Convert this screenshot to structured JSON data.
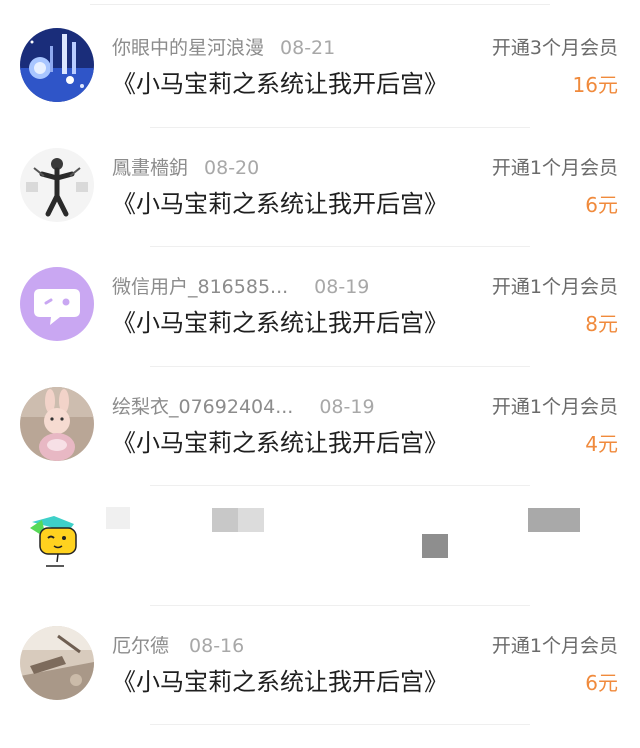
{
  "purchases": [
    {
      "username": "你眼中的星河浪漫",
      "date": "08-21",
      "book_title": "《小马宝莉之系统让我开后宫》",
      "plan": "开通3个月会员",
      "price": "16元",
      "avatar": "galaxy-icon"
    },
    {
      "username": "鳳畫檣鈅",
      "date": "08-20",
      "book_title": "《小马宝莉之系统让我开后宫》",
      "plan": "开通1个月会员",
      "price": "6元",
      "avatar": "sketch-figure-icon"
    },
    {
      "username": "微信用户_816585...",
      "date": "08-19",
      "book_title": "《小马宝莉之系统让我开后宫》",
      "plan": "开通1个月会员",
      "price": "8元",
      "avatar": "chat-bubble-icon"
    },
    {
      "username": "绘梨衣_07692404...",
      "date": "08-19",
      "book_title": "《小马宝莉之系统让我开后宫》",
      "plan": "开通1个月会员",
      "price": "4元",
      "avatar": "plush-bunny-icon"
    },
    {
      "username": "",
      "date": "",
      "book_title": "",
      "plan": "",
      "price": "",
      "avatar": "emoji-face-icon"
    },
    {
      "username": "厄尔德",
      "date": "08-16",
      "book_title": "《小马宝莉之系统让我开后宫》",
      "plan": "开通1个月会员",
      "price": "6元",
      "avatar": "photo-icon"
    }
  ],
  "colors": {
    "price": "#f08a3c",
    "avatar_purple": "#c9a7f2"
  }
}
